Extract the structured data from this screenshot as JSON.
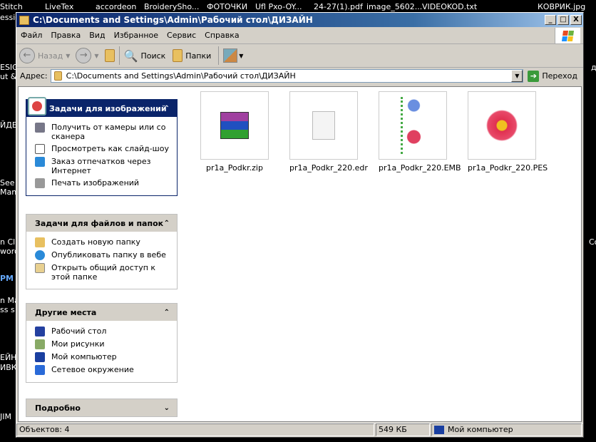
{
  "desktop": {
    "top_labels": [
      "Stitch",
      "LiveTex",
      "accordeon",
      "BroiderySho...",
      "ФОТОЧКИ",
      "Ufl Pxo-OY...",
      "24-27(1).pdf",
      "image_5602...",
      "VIDEOKOD.txt",
      "КОВРИК.jpg"
    ],
    "side_labels": [
      "essio",
      "ESIG",
      "ut &",
      "ЙДЕ",
      "See",
      "Man",
      "n Cl",
      "word",
      "PM",
      "n Ma",
      "ss s",
      "ЕЙН",
      "ИВК",
      "JIM",
      "д",
      "Co"
    ]
  },
  "window": {
    "title": "C:\\Documents and Settings\\Admin\\Рабочий стол\\ДИЗАЙН",
    "min": "_",
    "max": "□",
    "close": "X"
  },
  "menu": [
    "Файл",
    "Правка",
    "Вид",
    "Избранное",
    "Сервис",
    "Справка"
  ],
  "toolbar": {
    "back": "Назад",
    "search": "Поиск",
    "folders": "Папки"
  },
  "address": {
    "label": "Адрес:",
    "value": "C:\\Documents and Settings\\Admin\\Рабочий стол\\ДИЗАЙН",
    "go": "Переход"
  },
  "panels": [
    {
      "title": "Задачи для изображений",
      "items": [
        "Получить от камеры или со сканера",
        "Просмотреть как слайд-шоу",
        "Заказ отпечатков через Интернет",
        "Печать изображений"
      ]
    },
    {
      "title": "Задачи для файлов и папок",
      "items": [
        "Создать новую папку",
        "Опубликовать папку в вебе",
        "Открыть общий доступ к этой папке"
      ]
    },
    {
      "title": "Другие места",
      "items": [
        "Рабочий стол",
        "Мои рисунки",
        "Мой компьютер",
        "Сетевое окружение"
      ]
    },
    {
      "title": "Подробно"
    }
  ],
  "files": [
    {
      "name": "pr1a_Podkr.zip"
    },
    {
      "name": "pr1a_Podkr_220.edr"
    },
    {
      "name": "pr1a_Podkr_220.EMB"
    },
    {
      "name": "pr1a_Podkr_220.PES"
    }
  ],
  "status": {
    "objects": "Объектов: 4",
    "size": "549 КБ",
    "location": "Мой компьютер"
  }
}
